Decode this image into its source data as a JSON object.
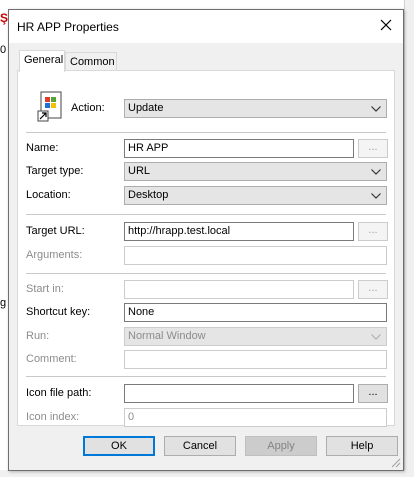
{
  "dialog": {
    "title": "HR APP Properties",
    "close_icon": "close-icon"
  },
  "tabs": [
    {
      "label": "General",
      "active": true
    },
    {
      "label": "Common",
      "active": false
    }
  ],
  "action": {
    "label": "Action:",
    "value": "Update",
    "icon": "shortcut-icon"
  },
  "form": {
    "name_label": "Name:",
    "name_value": "HR APP",
    "target_type_label": "Target type:",
    "target_type_value": "URL",
    "location_label": "Location:",
    "location_value": "Desktop",
    "target_url_label": "Target URL:",
    "target_url_value": "http://hrapp.test.local",
    "arguments_label": "Arguments:",
    "arguments_value": "",
    "start_in_label": "Start in:",
    "start_in_value": "",
    "shortcut_key_label": "Shortcut key:",
    "shortcut_key_value": "None",
    "run_label": "Run:",
    "run_value": "Normal Window",
    "comment_label": "Comment:",
    "comment_value": "",
    "icon_file_path_label": "Icon file path:",
    "icon_file_path_value": "",
    "icon_index_label": "Icon index:",
    "icon_index_value": "0",
    "browse_label": "..."
  },
  "buttons": {
    "ok": "OK",
    "cancel": "Cancel",
    "apply": "Apply",
    "help": "Help"
  },
  "background": {
    "left_fragment_1": "0",
    "left_fragment_2": "g"
  }
}
